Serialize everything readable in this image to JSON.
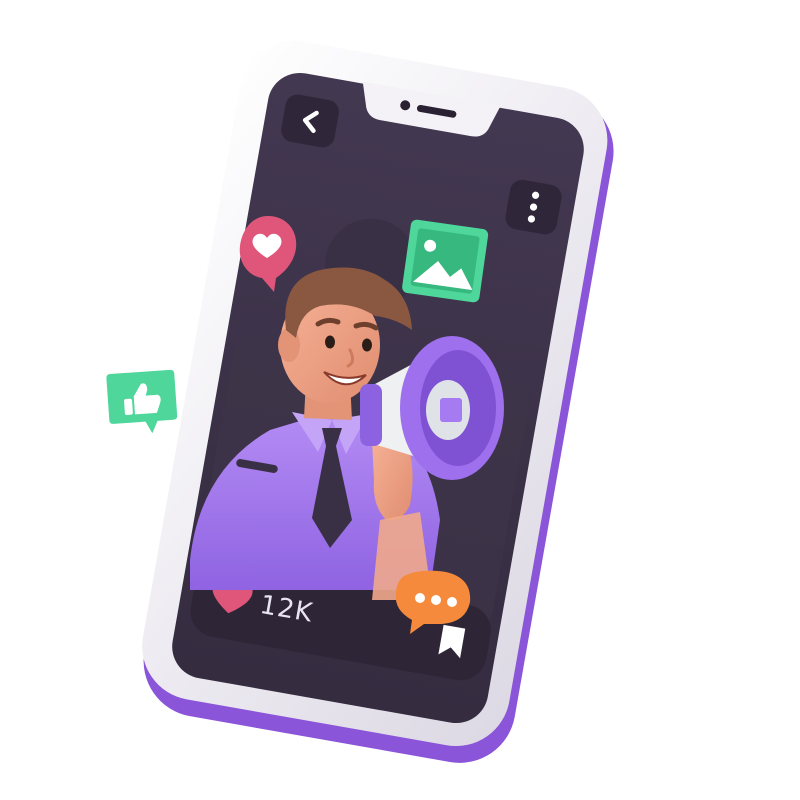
{
  "post": {
    "likes_count": "12K"
  },
  "icons": {
    "back": "chevron-left-icon",
    "menu": "more-vertical-icon",
    "like": "heart-icon",
    "bookmark": "bookmark-icon",
    "floating": [
      "heart-bubble-icon",
      "image-icon",
      "thumbs-up-bubble-icon",
      "chat-bubble-icon"
    ],
    "megaphone": "megaphone-icon"
  },
  "colors": {
    "phone_shell": "#f2f1f5",
    "phone_rim": "#8a55d8",
    "screen": "#3c3247",
    "accent_purple": "#a77ef0",
    "heart_pink": "#e0567a",
    "green": "#4ed69b",
    "orange": "#f58a3c"
  }
}
